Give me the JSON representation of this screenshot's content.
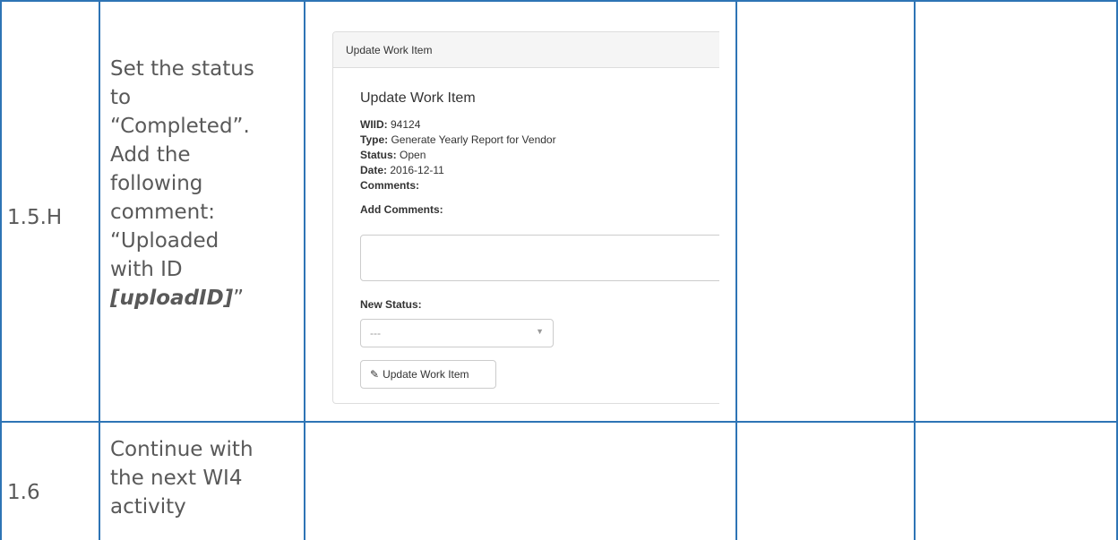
{
  "rows": [
    {
      "step": "1.5.H",
      "description_lines": [
        "Set the status",
        "to",
        "“Completed”.",
        "Add the",
        "following",
        "comment:",
        "“Uploaded",
        "with ID"
      ],
      "description_emphasis": "[uploadID]",
      "description_suffix": "”"
    },
    {
      "step": "1.6",
      "description_lines": [
        "Continue with",
        "the next WI4",
        "activity"
      ]
    }
  ],
  "update_panel": {
    "heading": "Update Work Item",
    "title": "Update Work Item",
    "fields": [
      {
        "label": "WIID:",
        "value": "94124"
      },
      {
        "label": "Type:",
        "value": "Generate Yearly Report for Vendor"
      },
      {
        "label": "Status:",
        "value": "Open"
      },
      {
        "label": "Date:",
        "value": "2016-12-11"
      },
      {
        "label": "Comments:",
        "value": ""
      }
    ],
    "add_comments_label": "Add Comments:",
    "comment_value": "",
    "new_status_label": "New Status:",
    "new_status_value": "---",
    "update_button_label": "Update Work Item"
  },
  "colors": {
    "grid": "#2e74b5",
    "text": "#595959"
  }
}
